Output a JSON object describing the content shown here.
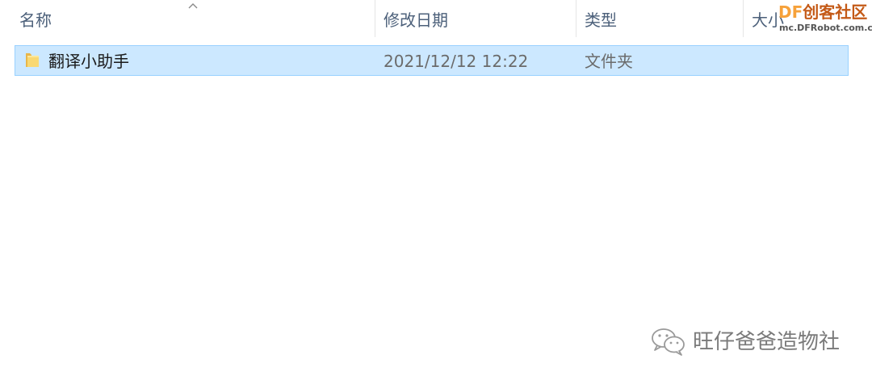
{
  "columns": {
    "name": "名称",
    "date_modified": "修改日期",
    "type": "类型",
    "size": "大小"
  },
  "rows": [
    {
      "name": "翻译小助手",
      "date_modified": "2021/12/12 12:22",
      "type": "文件夹",
      "icon": "folder-icon",
      "selected": true
    }
  ],
  "watermarks": {
    "df_logo_letters": "DF",
    "df_logo_text": "创客社区",
    "df_url": "mc.DFRobot.com.cn",
    "wechat_account": "旺仔爸爸造物社"
  },
  "colors": {
    "selection_fill": "#cce8ff",
    "selection_border": "#99d1ff",
    "header_text": "#4c607a",
    "df_orange": "#f6a13a",
    "df_dark_orange": "#c45a17"
  }
}
